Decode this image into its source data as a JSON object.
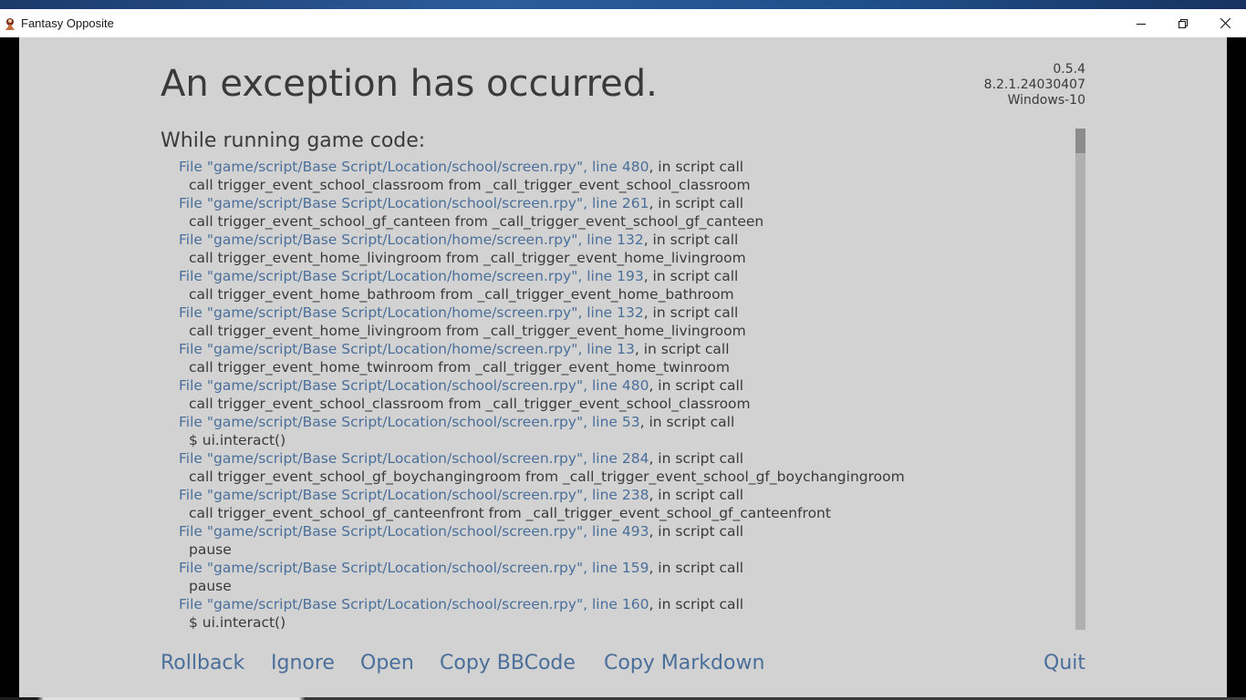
{
  "window": {
    "title": "Fantasy Opposite",
    "controls": [
      {
        "name": "minimize-icon"
      },
      {
        "name": "restore-icon"
      },
      {
        "name": "close-icon"
      }
    ]
  },
  "exception": {
    "title": "An exception has occurred.",
    "version": [
      "0.5.4",
      "8.2.1.24030407",
      "Windows-10"
    ],
    "context": "While running game code:",
    "traceback": [
      {
        "type": "file",
        "link": "File \"game/script/Base Script/Location/school/screen.rpy\", line 480",
        "rest": ", in script call"
      },
      {
        "type": "code",
        "text": "call trigger_event_school_classroom from _call_trigger_event_school_classroom"
      },
      {
        "type": "file",
        "link": "File \"game/script/Base Script/Location/school/screen.rpy\", line 261",
        "rest": ", in script call"
      },
      {
        "type": "code",
        "text": "call trigger_event_school_gf_canteen from _call_trigger_event_school_gf_canteen"
      },
      {
        "type": "file",
        "link": "File \"game/script/Base Script/Location/home/screen.rpy\", line 132",
        "rest": ", in script call"
      },
      {
        "type": "code",
        "text": "call trigger_event_home_livingroom from _call_trigger_event_home_livingroom"
      },
      {
        "type": "file",
        "link": "File \"game/script/Base Script/Location/home/screen.rpy\", line 193",
        "rest": ", in script call"
      },
      {
        "type": "code",
        "text": "call trigger_event_home_bathroom from _call_trigger_event_home_bathroom"
      },
      {
        "type": "file",
        "link": "File \"game/script/Base Script/Location/home/screen.rpy\", line 132",
        "rest": ", in script call"
      },
      {
        "type": "code",
        "text": "call trigger_event_home_livingroom from _call_trigger_event_home_livingroom"
      },
      {
        "type": "file",
        "link": "File \"game/script/Base Script/Location/home/screen.rpy\", line 13",
        "rest": ", in script call"
      },
      {
        "type": "code",
        "text": "call trigger_event_home_twinroom from _call_trigger_event_home_twinroom"
      },
      {
        "type": "file",
        "link": "File \"game/script/Base Script/Location/school/screen.rpy\", line 480",
        "rest": ", in script call"
      },
      {
        "type": "code",
        "text": "call trigger_event_school_classroom from _call_trigger_event_school_classroom"
      },
      {
        "type": "file",
        "link": "File \"game/script/Base Script/Location/school/screen.rpy\", line 53",
        "rest": ", in script call"
      },
      {
        "type": "code",
        "text": "$ ui.interact()"
      },
      {
        "type": "file",
        "link": "File \"game/script/Base Script/Location/school/screen.rpy\", line 284",
        "rest": ", in script call"
      },
      {
        "type": "code",
        "text": "call trigger_event_school_gf_boychangingroom from _call_trigger_event_school_gf_boychangingroom"
      },
      {
        "type": "file",
        "link": "File \"game/script/Base Script/Location/school/screen.rpy\", line 238",
        "rest": ", in script call"
      },
      {
        "type": "code",
        "text": "call trigger_event_school_gf_canteenfront from _call_trigger_event_school_gf_canteenfront"
      },
      {
        "type": "file",
        "link": "File \"game/script/Base Script/Location/school/screen.rpy\", line 493",
        "rest": ", in script call"
      },
      {
        "type": "code",
        "text": "pause"
      },
      {
        "type": "file",
        "link": "File \"game/script/Base Script/Location/school/screen.rpy\", line 159",
        "rest": ", in script call"
      },
      {
        "type": "code",
        "text": "pause"
      },
      {
        "type": "file",
        "link": "File \"game/script/Base Script/Location/school/screen.rpy\", line 160",
        "rest": ", in script call"
      },
      {
        "type": "code",
        "text": "$ ui.interact()"
      }
    ]
  },
  "actions": {
    "rollback": "Rollback",
    "ignore": "Ignore",
    "open": "Open",
    "copy_bbcode": "Copy BBCode",
    "copy_markdown": "Copy Markdown",
    "quit": "Quit"
  },
  "colors": {
    "background": "#d2d2d2",
    "text": "#3a3a3a",
    "link": "#4a6f9a"
  }
}
